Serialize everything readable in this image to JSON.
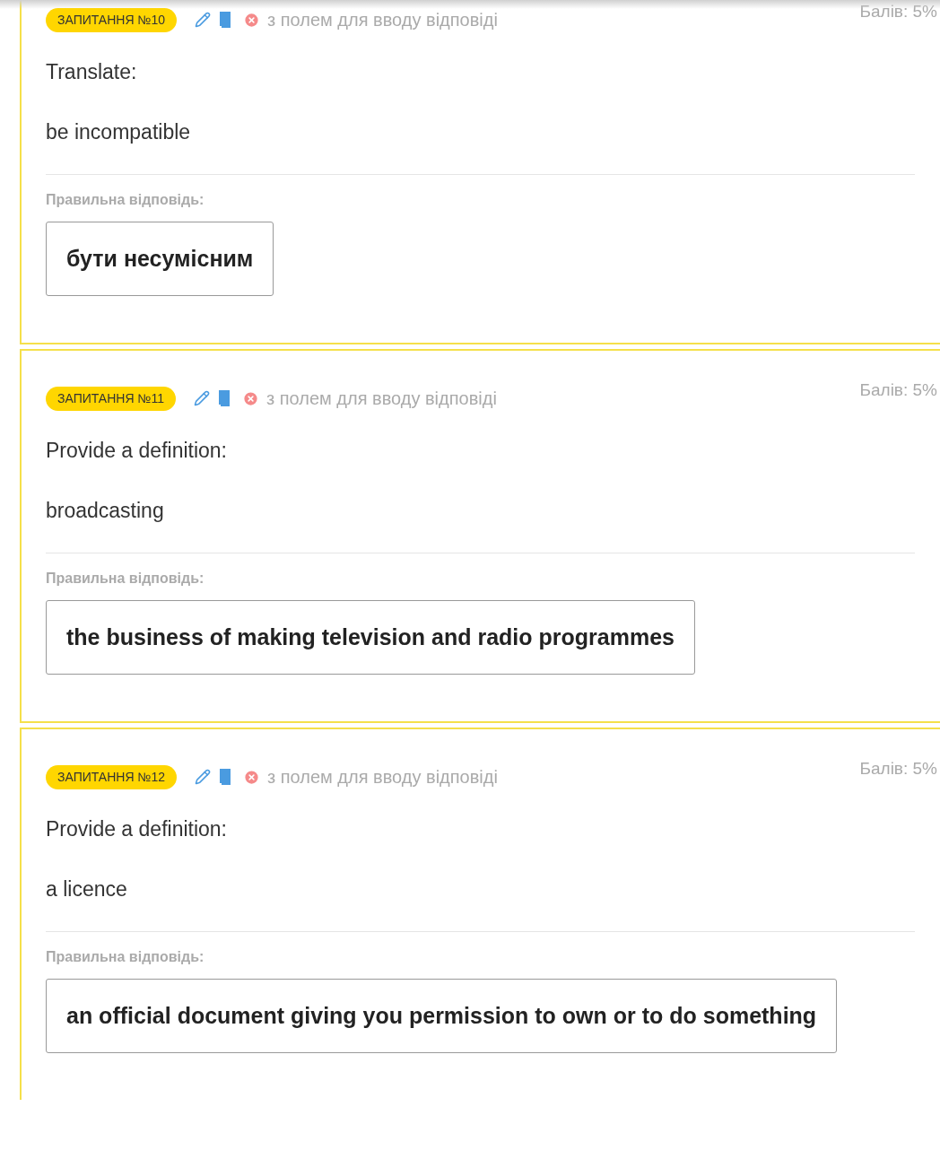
{
  "questions": [
    {
      "badge": "ЗАПИТАННЯ №10",
      "type": "з полем для вводу відповіді",
      "score": "Балів: 5%",
      "prompt": "Translate:",
      "term": "be incompatible",
      "answer_label": "Правильна відповідь:",
      "answer": "бути несумісним"
    },
    {
      "badge": "ЗАПИТАННЯ №11",
      "type": "з полем для вводу відповіді",
      "score": "Балів: 5%",
      "prompt": "Provide a definition:",
      "term": "broadcasting",
      "answer_label": "Правильна відповідь:",
      "answer": "the business of making television and radio programmes"
    },
    {
      "badge": "ЗАПИТАННЯ №12",
      "type": "з полем для вводу відповіді",
      "score": "Балів: 5%",
      "prompt": "Provide a definition:",
      "term": "a licence",
      "answer_label": "Правильна відповідь:",
      "answer": "an official document giving you permission to own or to do something"
    }
  ]
}
